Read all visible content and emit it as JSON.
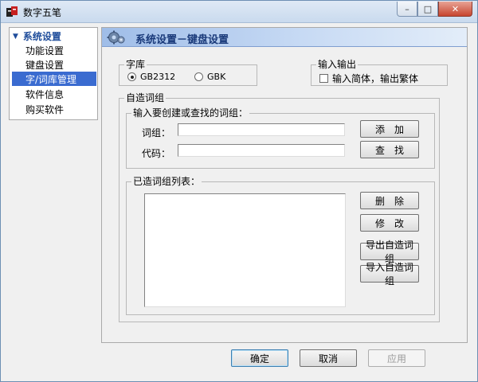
{
  "window": {
    "title": "数字五笔",
    "icon": "app-logo-icon",
    "controls": {
      "minimize": "–",
      "maximize": "□",
      "close": "✕"
    }
  },
  "nav": {
    "root_label": "系统设置",
    "items": [
      {
        "label": "功能设置",
        "selected": false
      },
      {
        "label": "键盘设置",
        "selected": false
      },
      {
        "label": "字/词库管理",
        "selected": true
      },
      {
        "label": "软件信息",
        "selected": false
      },
      {
        "label": "购买软件",
        "selected": false
      }
    ]
  },
  "panel": {
    "title": "系统设置－键盘设置",
    "icon": "gear-icon"
  },
  "charset": {
    "label": "字库",
    "options": [
      "GB2312",
      "GBK"
    ],
    "selected": "GB2312"
  },
  "io": {
    "label": "输入输出",
    "checkbox_label": "输入简体，输出繁体",
    "checked": false
  },
  "custom_phrase": {
    "label": "自造词组",
    "entry_group_label": "输入要创建或查找的词组：",
    "phrase_label": "词组：",
    "phrase_value": "",
    "code_label": "代码：",
    "code_value": "",
    "add_button": "添　加",
    "find_button": "查　找",
    "list_group_label": "已造词组列表：",
    "list_items": [],
    "delete_button": "删　除",
    "modify_button": "修　改",
    "export_button": "导出自造词组",
    "import_button": "导入自造词组"
  },
  "footer": {
    "ok": "确定",
    "cancel": "取消",
    "apply": "应用"
  }
}
